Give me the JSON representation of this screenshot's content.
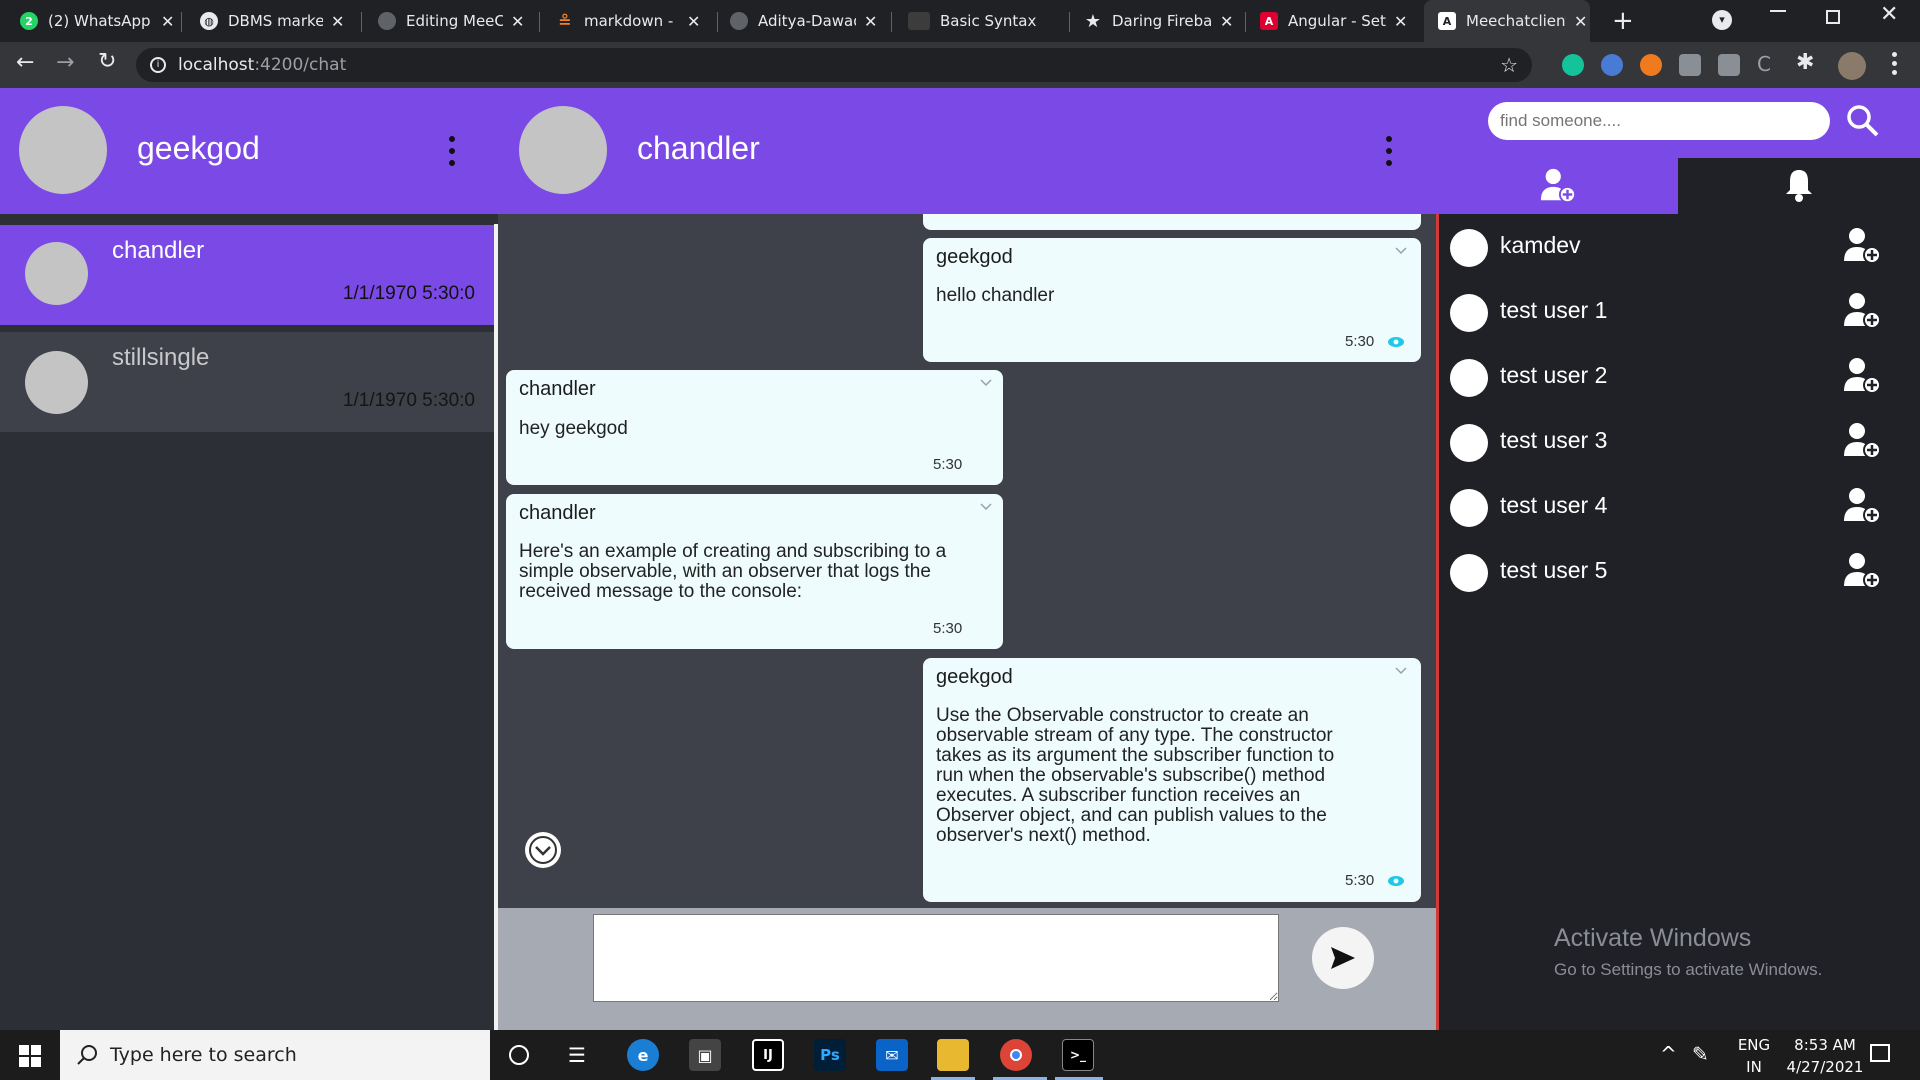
{
  "browser": {
    "tabs": [
      {
        "title": "(2) WhatsApp",
        "icon": "whatsapp-icon",
        "color": "#25d366"
      },
      {
        "title": "DBMS marked",
        "icon": "globe-icon",
        "color": "#e8eaed"
      },
      {
        "title": "Editing MeeCh",
        "icon": "github-icon",
        "color": "#5f6368"
      },
      {
        "title": "markdown - H",
        "icon": "stackoverflow-icon",
        "color": "#f48024"
      },
      {
        "title": "Aditya-Dawad",
        "icon": "github-icon",
        "color": "#5f6368"
      },
      {
        "title": "Basic Syntax | ",
        "icon": "markdown-guide-icon",
        "color": "#444"
      },
      {
        "title": "Daring Fireball",
        "icon": "star-icon",
        "color": "#e8eaed"
      },
      {
        "title": "Angular - Setti",
        "icon": "angular-icon",
        "color": "#dd0031"
      },
      {
        "title": "Meechatclient",
        "icon": "angular-icon",
        "color": "#ffffff"
      }
    ],
    "url_host": "localhost",
    "url_path": ":4200/chat"
  },
  "me": {
    "name": "geekgod"
  },
  "conversations": [
    {
      "name": "chandler",
      "time": "1/1/1970 5:30:0",
      "active": true
    },
    {
      "name": "stillsingle",
      "time": "1/1/1970 5:30:0",
      "active": false
    }
  ],
  "chat": {
    "title": "chandler",
    "messages": [
      {
        "sender": "geekgod",
        "text": "hello chandler",
        "time": "5:30",
        "seen": true
      },
      {
        "sender": "chandler",
        "text": "hey geekgod",
        "time": "5:30",
        "seen": false
      },
      {
        "sender": "chandler",
        "lines": [
          "Here's an example of creating and subscribing to a",
          "simple observable, with an observer that logs the",
          "received message to the console:"
        ],
        "time": "5:30",
        "seen": false
      },
      {
        "sender": "geekgod",
        "lines": [
          "Use the Observable constructor to create an",
          "observable stream of any type. The constructor",
          "takes as its argument the subscriber function to",
          "run when the observable's subscribe() method",
          "executes. A subscriber function receives an",
          "Observer object, and can publish values to the",
          "observer's next() method."
        ],
        "time": "5:30",
        "seen": true
      }
    ],
    "composer_value": ""
  },
  "search": {
    "placeholder": "find someone...."
  },
  "suggested_users": [
    {
      "name": "kamdev"
    },
    {
      "name": "test user 1"
    },
    {
      "name": "test user 2"
    },
    {
      "name": "test user 3"
    },
    {
      "name": "test user 4"
    },
    {
      "name": "test user 5"
    }
  ],
  "watermark": {
    "title": "Activate Windows",
    "subtitle": "Go to Settings to activate Windows."
  },
  "taskbar": {
    "search_placeholder": "Type here to search",
    "lang": "ENG",
    "region": "IN",
    "time": "8:53 AM",
    "date": "4/27/2021"
  },
  "colors": {
    "accent": "#7b4ae6",
    "chat_bg": "#3e4149",
    "bubble": "#eefcfe",
    "seen": "#1ec8e6"
  }
}
